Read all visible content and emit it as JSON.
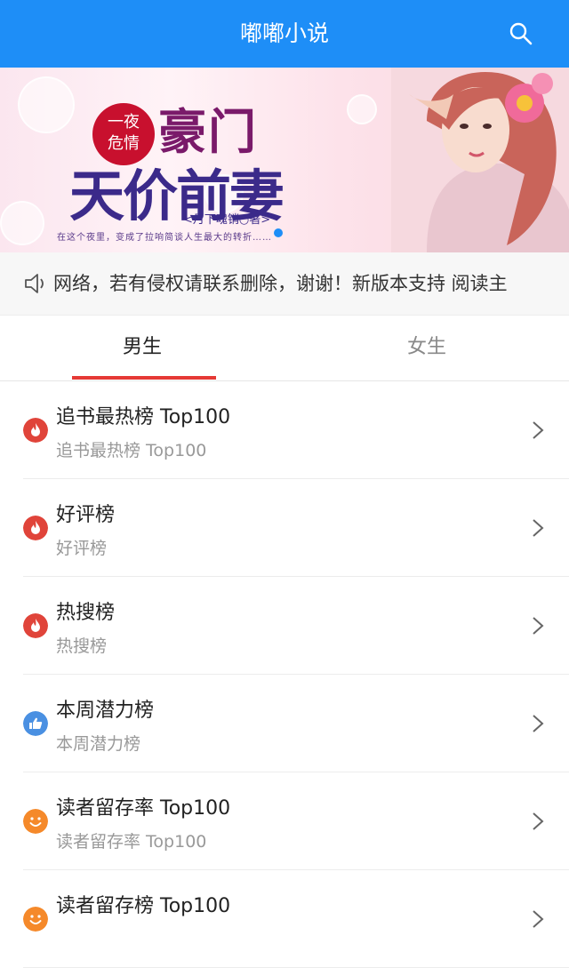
{
  "header": {
    "title": "嘟嘟小说",
    "search_icon": "search-icon"
  },
  "banner": {
    "badge_line1": "一夜",
    "badge_line2": "危情",
    "title_line1": "豪门",
    "title_line2": "天价前妻",
    "author": "<月下魂销○著>",
    "caption": "在这个夜里，变成了拉响简谈人生最大的转折……"
  },
  "notice": {
    "icon": "speaker-icon",
    "text": "网络，若有侵权请联系删除，谢谢！新版本支持 阅读主"
  },
  "tabs": [
    {
      "label": "男生",
      "active": true
    },
    {
      "label": "女生",
      "active": false
    }
  ],
  "colors": {
    "header": "#1e8ef7",
    "accent": "#e53935",
    "fire": "#e0443a",
    "thumb": "#4a90e2",
    "smile": "#f5892a"
  },
  "rankings": [
    {
      "title": "追书最热榜 Top100",
      "subtitle": "追书最热榜 Top100",
      "icon": "fire-icon"
    },
    {
      "title": "好评榜",
      "subtitle": "好评榜",
      "icon": "fire-icon"
    },
    {
      "title": "热搜榜",
      "subtitle": "热搜榜",
      "icon": "fire-icon"
    },
    {
      "title": "本周潜力榜",
      "subtitle": "本周潜力榜",
      "icon": "thumbs-up-icon"
    },
    {
      "title": "读者留存率 Top100",
      "subtitle": "读者留存率 Top100",
      "icon": "smile-icon"
    },
    {
      "title": "读者留存榜 Top100",
      "subtitle": "",
      "icon": "smile-icon"
    }
  ]
}
